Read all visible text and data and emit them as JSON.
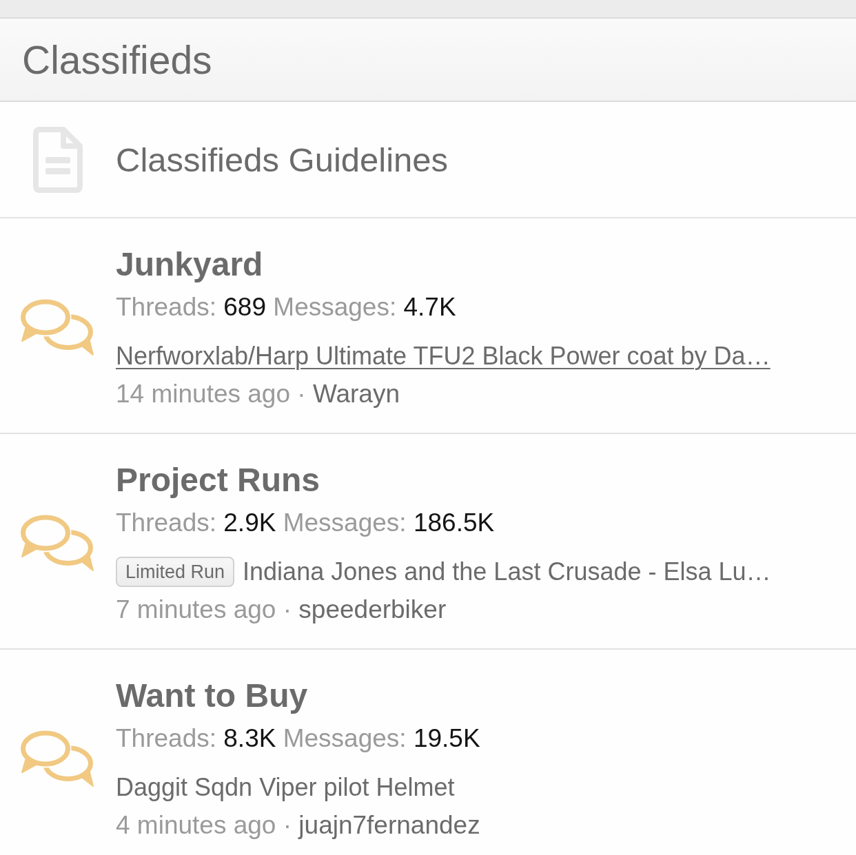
{
  "section": {
    "title": "Classifieds"
  },
  "guidelines": {
    "label": "Classifieds Guidelines"
  },
  "forums": [
    {
      "title": "Junkyard",
      "stats": [
        {
          "label": "Threads:",
          "value": "689"
        },
        {
          "label": "Messages:",
          "value": "4.7K"
        }
      ],
      "latest": {
        "title": "Nerfworxlab/Harp Ultimate TFU2 Black Power coat by Da…",
        "underlined": true
      },
      "meta": {
        "time": "14 minutes ago",
        "separator": "·",
        "user": "Warayn"
      }
    },
    {
      "title": "Project Runs",
      "stats": [
        {
          "label": "Threads:",
          "value": "2.9K"
        },
        {
          "label": "Messages:",
          "value": "186.5K"
        }
      ],
      "latest": {
        "prefix": "Limited Run",
        "title": "Indiana Jones and the Last Crusade - Elsa Lu…",
        "underlined": false
      },
      "meta": {
        "time": "7 minutes ago",
        "separator": "·",
        "user": "speederbiker"
      }
    },
    {
      "title": "Want to Buy",
      "stats": [
        {
          "label": "Threads:",
          "value": "8.3K"
        },
        {
          "label": "Messages:",
          "value": "19.5K"
        }
      ],
      "latest": {
        "title": "Daggit Sqdn Viper pilot Helmet",
        "underlined": false
      },
      "meta": {
        "time": "4 minutes ago",
        "separator": "·",
        "user": "juajn7fernandez"
      }
    }
  ]
}
